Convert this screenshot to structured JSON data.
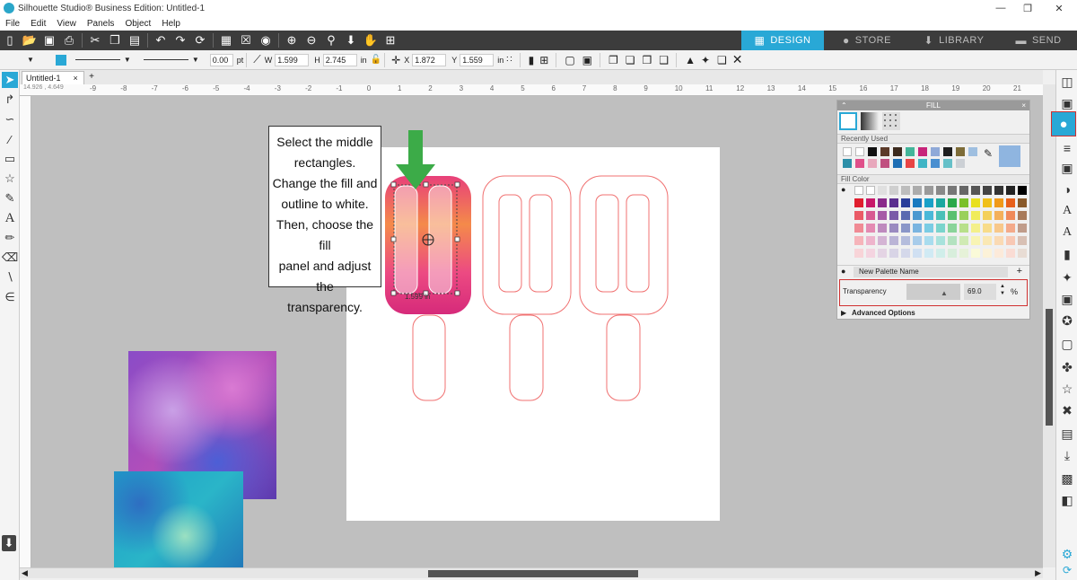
{
  "window": {
    "title": "Silhouette Studio® Business Edition: Untitled-1",
    "controls": [
      "—",
      "❐",
      "✕"
    ]
  },
  "menu": [
    "File",
    "Edit",
    "View",
    "Panels",
    "Object",
    "Help"
  ],
  "nav_tabs": [
    {
      "label": "DESIGN",
      "icon": "grid-icon",
      "active": true
    },
    {
      "label": "STORE",
      "icon": "silhouette-s-icon",
      "active": false
    },
    {
      "label": "LIBRARY",
      "icon": "download-icon",
      "active": false
    },
    {
      "label": "SEND",
      "icon": "cutter-icon",
      "active": false
    }
  ],
  "properties": {
    "line_width": "0.00",
    "line_unit": "pt",
    "w_label": "W",
    "w_value": "1.599",
    "h_label": "H",
    "h_value": "2.745",
    "size_unit": "in",
    "x_label": "X",
    "x_value": "1.872",
    "y_label": "Y",
    "y_value": "1.559",
    "pos_unit": "in"
  },
  "document": {
    "tab_label": "Untitled-1",
    "add_tab": "+",
    "cursor_coords": "14.926 , 4.649",
    "selection_label": "1.599 in"
  },
  "ruler_ticks": [
    "-9",
    "-8",
    "-7",
    "-6",
    "-5",
    "-4",
    "-3",
    "-2",
    "-1",
    "0",
    "1",
    "2",
    "3",
    "4",
    "5",
    "6",
    "7",
    "8",
    "9",
    "10",
    "11",
    "12",
    "13",
    "14",
    "15",
    "16",
    "17",
    "18",
    "19",
    "20",
    "21"
  ],
  "callout": {
    "lines": [
      "Select the middle",
      "rectangles.",
      "Change the fill and",
      "outline to white.",
      "Then, choose the fill",
      "panel and adjust the",
      "transparency."
    ]
  },
  "fill_panel": {
    "title": "FILL",
    "recently_used_label": "Recently Used",
    "fill_color_label": "Fill Color",
    "new_palette_label": "New Palette Name",
    "transparency_label": "Transparency",
    "transparency_value": "69.0",
    "transparency_unit": "%",
    "advanced_label": "Advanced Options",
    "recent_colors": [
      "#ffffff",
      "#ffffff",
      "#111111",
      "#5b3a29",
      "#3c2a1e",
      "#43b59a",
      "#c7257a",
      "#8fa9d8",
      "#1f1f1f",
      "#7d6c38",
      "#9fbfe0",
      "#2c8fa8",
      "#e0508a",
      "#e8a8bc",
      "#c05080",
      "#1e6fb5",
      "#e84545",
      "#40b5c5",
      "#4a8fd0",
      "#66c0c8",
      "#ccd0d5"
    ],
    "palette_rows": [
      [
        "#ffffff",
        "#ffffff",
        "#e0e0e0",
        "#cfcfcf",
        "#bdbdbd",
        "#acacac",
        "#9a9a9a",
        "#898989",
        "#777777",
        "#666666",
        "#555555",
        "#444444",
        "#333333",
        "#222222",
        "#000000"
      ],
      [
        "#e01e2e",
        "#c8186a",
        "#8a2a8a",
        "#5a2e8e",
        "#2a3e9a",
        "#1a7ac0",
        "#1aa0c8",
        "#1aa8a0",
        "#2aa84a",
        "#7ac02a",
        "#e8e020",
        "#f0c01a",
        "#f09a1a",
        "#e8601a",
        "#8a5a2a"
      ],
      [
        "#ea5a66",
        "#d85a92",
        "#a65aa6",
        "#7a5aa8",
        "#5a6ab0",
        "#4a98d0",
        "#4ab8d8",
        "#4ac0b8",
        "#5ac070",
        "#9ad05a",
        "#f0ec5a",
        "#f4d05a",
        "#f4b05a",
        "#f08a5a",
        "#a87a5a"
      ],
      [
        "#f08a94",
        "#e48ab2",
        "#be8abe",
        "#9a8ac0",
        "#8a96c8",
        "#7ab4e0",
        "#7acce4",
        "#7ad4cc",
        "#8ad49a",
        "#b8e08a",
        "#f4f08a",
        "#f8dc8a",
        "#f8c88a",
        "#f4aa8a",
        "#c09c8a"
      ],
      [
        "#f6b4ba",
        "#eeb4cc",
        "#d4b4d4",
        "#bab4d6",
        "#b4bcdc",
        "#a8ccea",
        "#a8dcee",
        "#a8e2dc",
        "#b4e2c0",
        "#d0eab4",
        "#f8f4b4",
        "#fae8b4",
        "#fadab4",
        "#f8c8b4",
        "#d8c0b4"
      ],
      [
        "#f8d4d8",
        "#f4d4e0",
        "#e4d4e4",
        "#d8d4e6",
        "#d4d8ea",
        "#d0e0f2",
        "#d0eaf4",
        "#d0eeea",
        "#d8eedc",
        "#e6f2d8",
        "#fafad8",
        "#fcf2d8",
        "#fceada",
        "#fadcd4",
        "#e8dcd4"
      ]
    ]
  },
  "colors": {
    "accent": "#29a8d6",
    "toolbar_bg": "#3c3c3c",
    "outline": "#f07070",
    "arrow": "#3cab48",
    "highlight_box": "#d03030"
  }
}
